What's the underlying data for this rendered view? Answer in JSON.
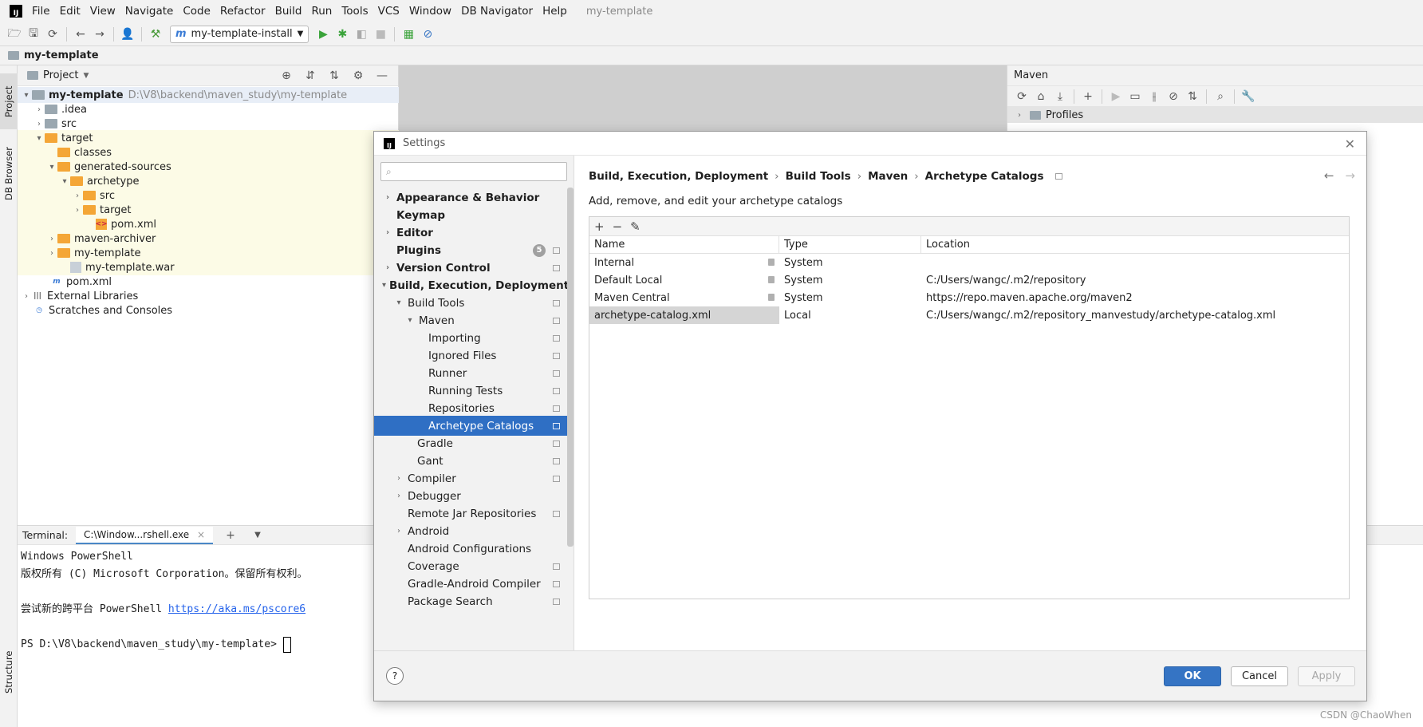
{
  "menubar": {
    "items": [
      "File",
      "Edit",
      "View",
      "Navigate",
      "Code",
      "Refactor",
      "Build",
      "Run",
      "Tools",
      "VCS",
      "Window",
      "DB Navigator",
      "Help"
    ],
    "project": "my-template"
  },
  "toolbar": {
    "run_config": "my-template-install"
  },
  "navbar": {
    "project": "my-template"
  },
  "left_stripe": {
    "project_tab": "Project",
    "db_tab": "DB Browser",
    "structure_tab": "Structure"
  },
  "project_panel": {
    "title": "Project",
    "tree": [
      {
        "label": "my-template",
        "path": "D:\\V8\\backend\\maven_study\\my-template"
      },
      {
        "label": ".idea"
      },
      {
        "label": "src"
      },
      {
        "label": "target"
      },
      {
        "label": "classes"
      },
      {
        "label": "generated-sources"
      },
      {
        "label": "archetype"
      },
      {
        "label": "src"
      },
      {
        "label": "target"
      },
      {
        "label": "pom.xml"
      },
      {
        "label": "maven-archiver"
      },
      {
        "label": "my-template"
      },
      {
        "label": "my-template.war"
      },
      {
        "label": "pom.xml"
      },
      {
        "label": "External Libraries"
      },
      {
        "label": "Scratches and Consoles"
      }
    ]
  },
  "maven_panel": {
    "title": "Maven",
    "profiles": "Profiles"
  },
  "terminal": {
    "label": "Terminal:",
    "tab": "C:\\Window...rshell.exe",
    "lines": {
      "l1": "Windows PowerShell",
      "l2": "版权所有 (C) Microsoft Corporation。保留所有权利。",
      "l3_prefix": "尝试新的跨平台 PowerShell ",
      "l3_link": "https://aka.ms/pscore6",
      "l4": "PS D:\\V8\\backend\\maven_study\\my-template> "
    }
  },
  "settings": {
    "title": "Settings",
    "nav": [
      {
        "label": "Appearance & Behavior"
      },
      {
        "label": "Keymap"
      },
      {
        "label": "Editor"
      },
      {
        "label": "Plugins",
        "badge": "5"
      },
      {
        "label": "Version Control"
      },
      {
        "label": "Build, Execution, Deployment"
      },
      {
        "label": "Build Tools"
      },
      {
        "label": "Maven"
      },
      {
        "label": "Importing"
      },
      {
        "label": "Ignored Files"
      },
      {
        "label": "Runner"
      },
      {
        "label": "Running Tests"
      },
      {
        "label": "Repositories"
      },
      {
        "label": "Archetype Catalogs"
      },
      {
        "label": "Gradle"
      },
      {
        "label": "Gant"
      },
      {
        "label": "Compiler"
      },
      {
        "label": "Debugger"
      },
      {
        "label": "Remote Jar Repositories"
      },
      {
        "label": "Android"
      },
      {
        "label": "Android Configurations"
      },
      {
        "label": "Coverage"
      },
      {
        "label": "Gradle-Android Compiler"
      },
      {
        "label": "Package Search"
      }
    ],
    "breadcrumb": [
      "Build, Execution, Deployment",
      "Build Tools",
      "Maven",
      "Archetype Catalogs"
    ],
    "description": "Add, remove, and edit your archetype catalogs",
    "table": {
      "columns": [
        "Name",
        "Type",
        "Location"
      ],
      "rows": [
        {
          "name": "Internal",
          "type": "System",
          "location": ""
        },
        {
          "name": "Default Local",
          "type": "System",
          "location": "C:/Users/wangc/.m2/repository"
        },
        {
          "name": "Maven Central",
          "type": "System",
          "location": "https://repo.maven.apache.org/maven2"
        },
        {
          "name": "archetype-catalog.xml",
          "type": "Local",
          "location": "C:/Users/wangc/.m2/repository_manvestudy/archetype-catalog.xml"
        }
      ]
    },
    "buttons": {
      "ok": "OK",
      "cancel": "Cancel",
      "apply": "Apply",
      "help": "?"
    }
  },
  "watermark": "CSDN @ChaoWhen"
}
